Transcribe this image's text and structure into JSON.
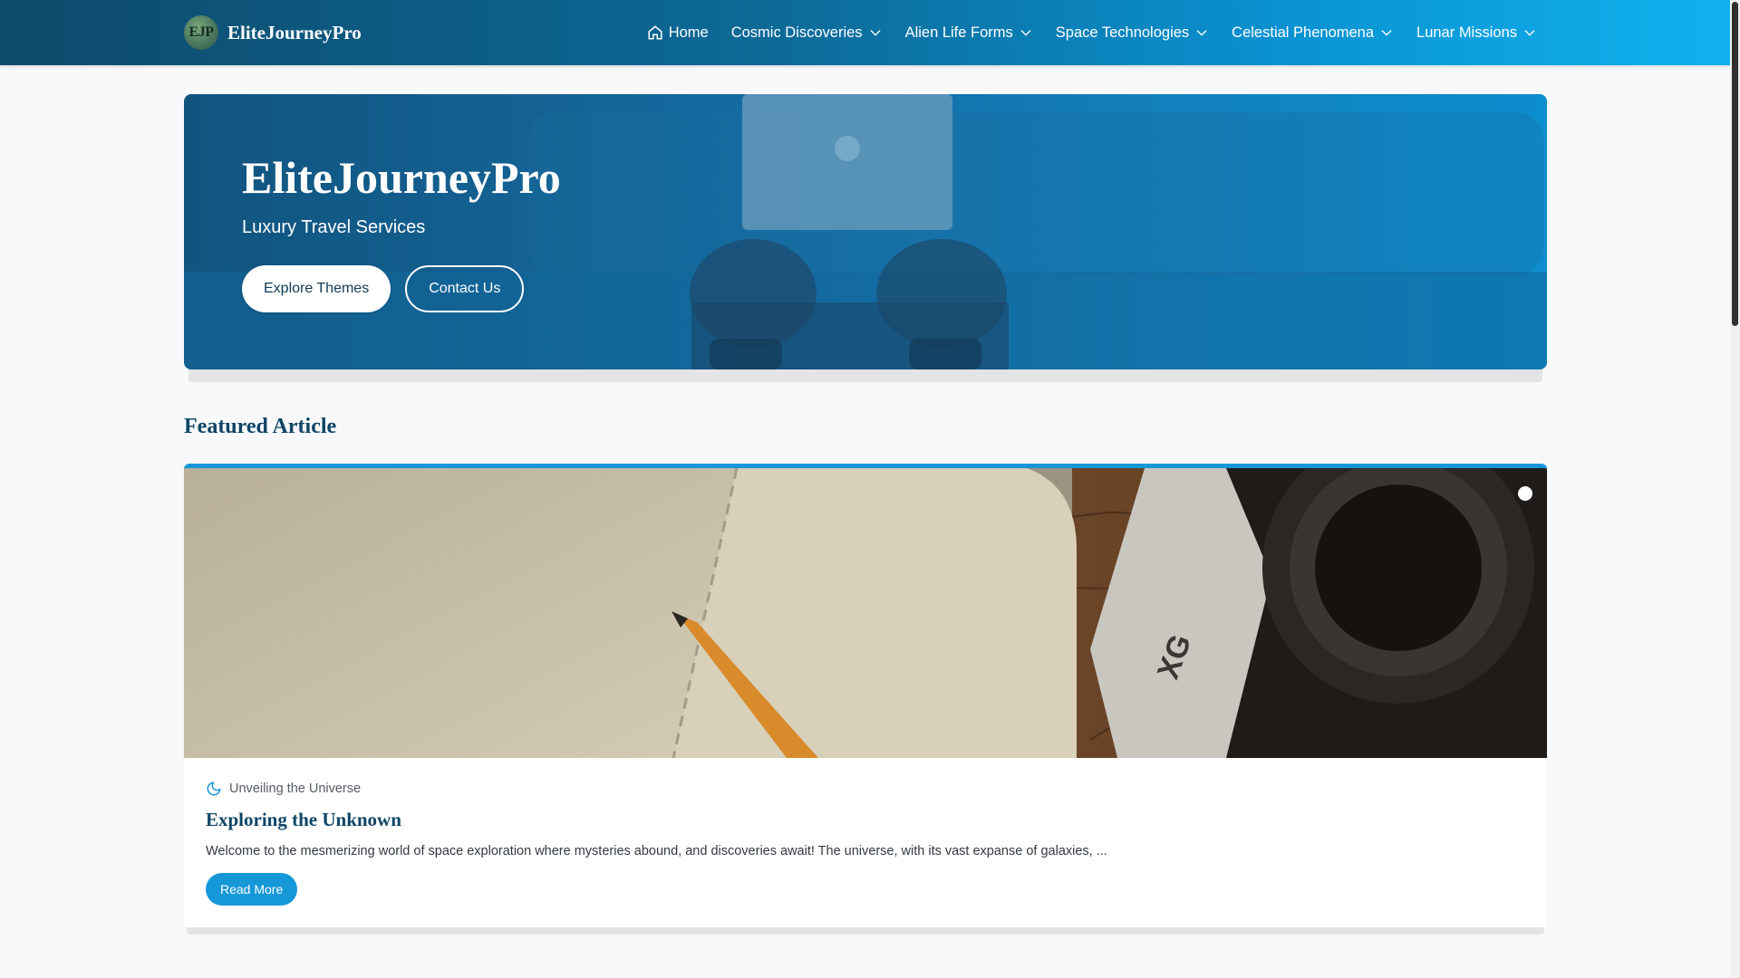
{
  "brand": {
    "logo_text": "EJP",
    "name": "EliteJourneyPro"
  },
  "nav": {
    "items": [
      {
        "label": "Home",
        "icon": "home-icon"
      },
      {
        "label": "Cosmic Discoveries",
        "icon": "chevron-down-icon"
      },
      {
        "label": "Alien Life Forms",
        "icon": "chevron-down-icon"
      },
      {
        "label": "Space Technologies",
        "icon": "chevron-down-icon"
      },
      {
        "label": "Celestial Phenomena",
        "icon": "chevron-down-icon"
      },
      {
        "label": "Lunar Missions",
        "icon": "chevron-down-icon"
      }
    ]
  },
  "hero": {
    "title": "EliteJourneyPro",
    "subtitle": "Luxury Travel Services",
    "primary_button": "Explore Themes",
    "secondary_button": "Contact Us"
  },
  "featured": {
    "section_title": "Featured Article",
    "category_icon": "moon-icon",
    "category": "Unveiling the Universe",
    "title": "Exploring the Unknown",
    "excerpt": "Welcome to the mesmerizing world of space exploration where mysteries abound, and discoveries await! The universe, with its vast expanse of galaxies, ...",
    "read_more": "Read More"
  },
  "colors": {
    "accent": "#1597d8",
    "heading": "#0f4566",
    "nav_gradient_start": "#0e4a6b",
    "nav_gradient_end": "#10b2ee"
  }
}
